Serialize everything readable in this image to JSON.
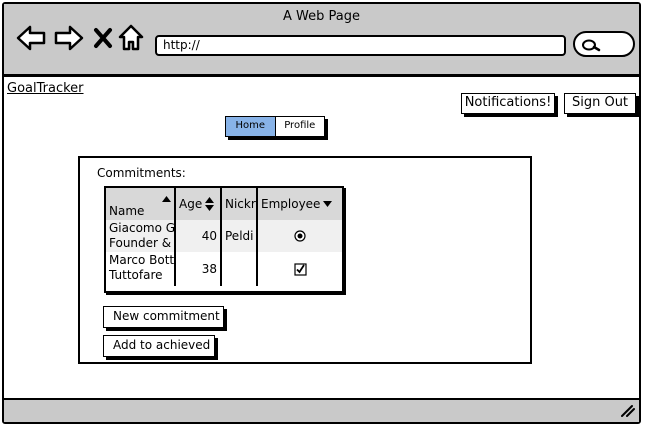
{
  "browser": {
    "window_title": "A Web Page",
    "url": "http://"
  },
  "app": {
    "logo": "GoalTracker",
    "notifications_label": "Notifications!",
    "signout_label": "Sign Out",
    "tabs": [
      {
        "label": "Home",
        "active": true
      },
      {
        "label": "Profile",
        "active": false
      }
    ]
  },
  "commitments": {
    "heading": "Commitments:",
    "columns": [
      "Name\n(job title",
      "Age",
      "Nickr",
      "Employee"
    ],
    "rows": [
      {
        "name": "Giacomo G",
        "title": "Founder &",
        "age": "40",
        "nick": "Peldi",
        "employee": "radio-selected"
      },
      {
        "name": "Marco Bott",
        "title": "Tuttofare",
        "age": "38",
        "nick": "",
        "employee": "checkbox-checked"
      }
    ],
    "new_button": "New commitment",
    "achieved_button": "Add to achieved"
  },
  "colors": {
    "chrome": "#c9c9c9",
    "active_tab": "#88b3e8",
    "table_header": "#d8d8d8"
  }
}
